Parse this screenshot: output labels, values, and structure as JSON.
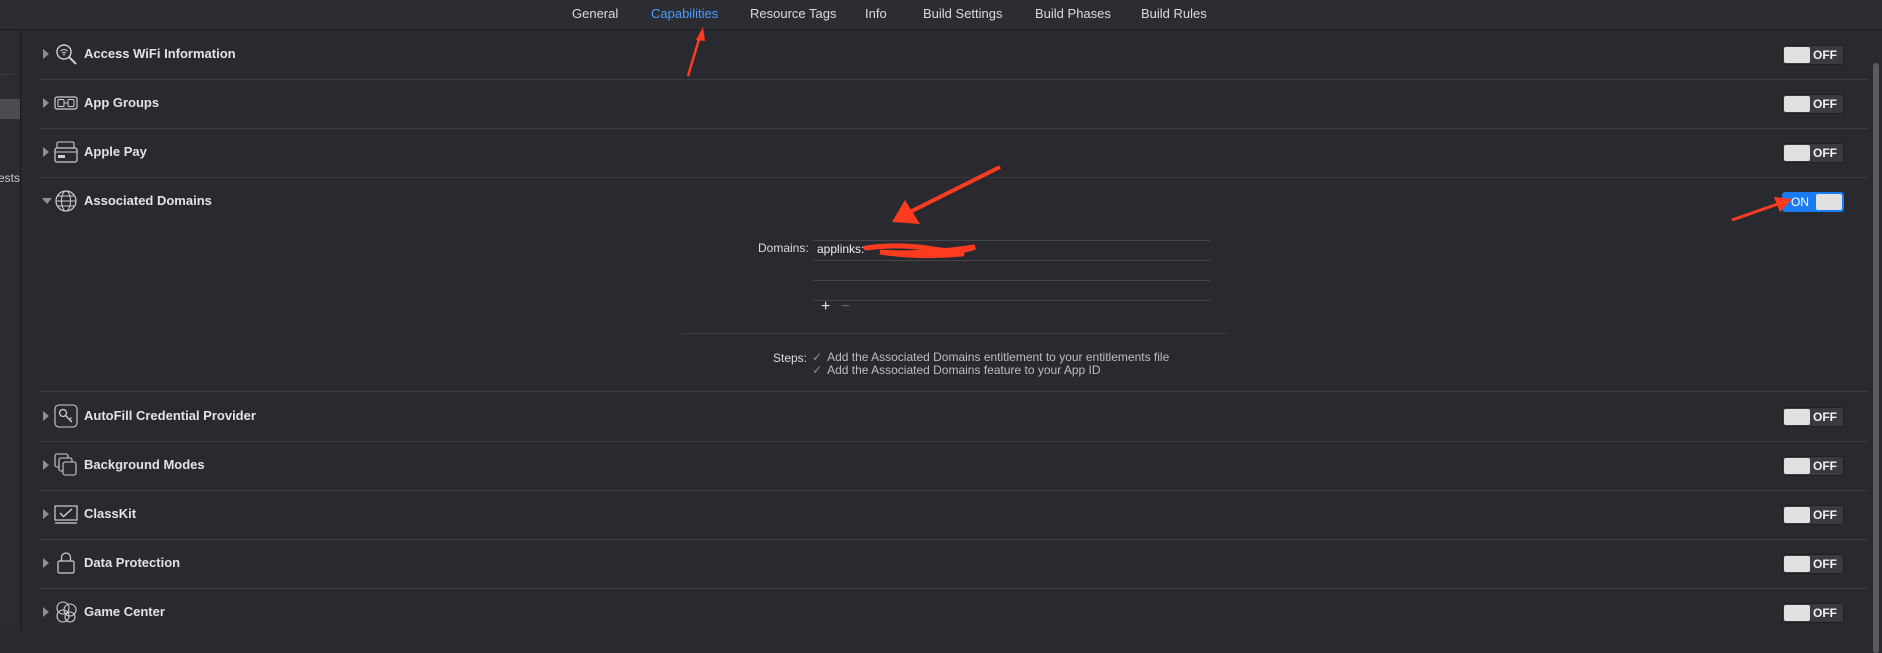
{
  "tabs": [
    {
      "label": "General",
      "active": false
    },
    {
      "label": "Capabilities",
      "active": true
    },
    {
      "label": "Resource Tags",
      "active": false
    },
    {
      "label": "Info",
      "active": false
    },
    {
      "label": "Build Settings",
      "active": false
    },
    {
      "label": "Build Phases",
      "active": false
    },
    {
      "label": "Build Rules",
      "active": false
    }
  ],
  "sidebar": {
    "partial_text": "ests"
  },
  "capabilities": [
    {
      "title": "Access WiFi Information",
      "state": "OFF",
      "icon": "magnifier-wifi-icon"
    },
    {
      "title": "App Groups",
      "state": "OFF",
      "icon": "app-groups-icon"
    },
    {
      "title": "Apple Pay",
      "state": "OFF",
      "icon": "wallet-card-icon"
    },
    {
      "title": "Associated Domains",
      "state": "ON",
      "icon": "globe-icon",
      "expanded": true
    },
    {
      "title": "AutoFill Credential Provider",
      "state": "OFF",
      "icon": "key-icon"
    },
    {
      "title": "Background Modes",
      "state": "OFF",
      "icon": "layered-squares-icon"
    },
    {
      "title": "ClassKit",
      "state": "OFF",
      "icon": "classkit-board-icon"
    },
    {
      "title": "Data Protection",
      "state": "OFF",
      "icon": "padlock-icon"
    },
    {
      "title": "Game Center",
      "state": "OFF",
      "icon": "game-center-bubbles-icon"
    }
  ],
  "associated_domains": {
    "domains_label": "Domains:",
    "domains": [
      "applinks:"
    ],
    "add_label": "+",
    "remove_label": "−",
    "steps_label": "Steps:",
    "steps": [
      "Add the Associated Domains entitlement to your entitlements file",
      "Add the Associated Domains feature to your App ID"
    ]
  },
  "colors": {
    "background": "#292a30",
    "accent": "#4a9eff",
    "toggle_on": "#1a7bf2",
    "annotation": "#ff3b1f"
  }
}
